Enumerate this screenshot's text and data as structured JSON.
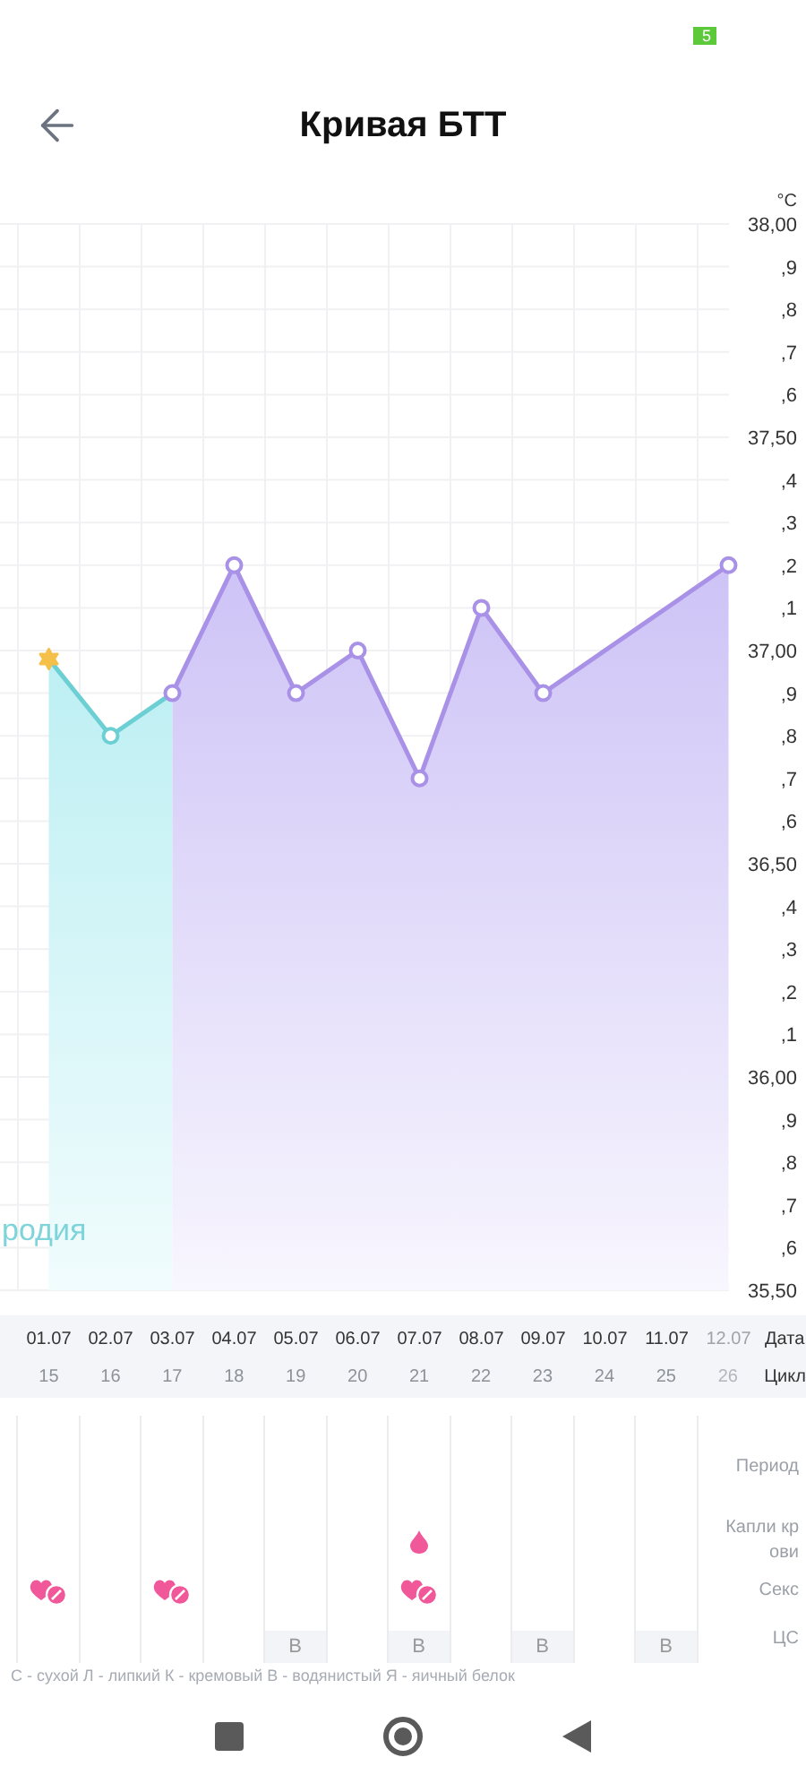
{
  "status_bar": {
    "battery": "5"
  },
  "header": {
    "title": "Кривая БТТ"
  },
  "chart": {
    "unit": "°C",
    "minor_tick_labels": [
      ",9",
      ",8",
      ",7",
      ",6",
      ",4",
      ",3",
      ",2",
      ",1",
      ",9",
      ",8",
      ",7",
      ",6",
      ",4",
      ",3",
      ",2",
      ",1",
      ",9",
      ",8",
      ",7",
      ",6"
    ],
    "chart_data": {
      "type": "line",
      "grid": true,
      "categories": [
        "01.07",
        "02.07",
        "03.07",
        "04.07",
        "05.07",
        "06.07",
        "07.07",
        "08.07",
        "09.07",
        "10.07",
        "11.07",
        "12.07"
      ],
      "series": [
        {
          "name": "родия",
          "color": "#6ccfd4",
          "values": [
            36.98,
            36.8,
            36.9,
            null,
            null,
            null,
            null,
            null,
            null,
            null,
            null,
            null
          ]
        },
        {
          "color": "#a891e6",
          "marker": "circle",
          "values": [
            null,
            null,
            36.9,
            37.2,
            36.9,
            37.0,
            36.7,
            37.1,
            36.9,
            null,
            null,
            37.2
          ]
        },
        {
          "color": "#f5c04a",
          "marker": "cross",
          "values": [
            36.98,
            null,
            null,
            null,
            null,
            null,
            null,
            null,
            null,
            null,
            null,
            null
          ]
        }
      ],
      "ylim": [
        35.5,
        38.0
      ],
      "yticks": [
        {
          "value": 38.0,
          "label": "38,00"
        },
        {
          "value": 37.5,
          "label": "37,50"
        },
        {
          "value": 37.0,
          "label": "37,00"
        },
        {
          "value": 36.5,
          "label": "36,50"
        },
        {
          "value": 36.0,
          "label": "36,00"
        },
        {
          "value": 35.5,
          "label": "35,50"
        }
      ]
    }
  },
  "timeline": {
    "date_label": "Дата",
    "cycle_label": "Цикл",
    "days": [
      {
        "cycle_day": "15",
        "future": false
      },
      {
        "cycle_day": "16",
        "future": false
      },
      {
        "cycle_day": "17",
        "future": false
      },
      {
        "cycle_day": "18",
        "future": false
      },
      {
        "cycle_day": "19",
        "future": false
      },
      {
        "cycle_day": "20",
        "future": false
      },
      {
        "cycle_day": "21",
        "future": false
      },
      {
        "cycle_day": "22",
        "future": false
      },
      {
        "cycle_day": "23",
        "future": false
      },
      {
        "cycle_day": "24",
        "future": false
      },
      {
        "cycle_day": "25",
        "future": false
      },
      {
        "cycle_day": "26",
        "future": true
      }
    ]
  },
  "log": {
    "row_labels": [
      "Период",
      "Капли крови",
      "Секс",
      "ЦС"
    ],
    "days": [
      {
        "sex": true,
        "blood_drops": false
      },
      {
        "sex": false,
        "blood_drops": false
      },
      {
        "sex": true,
        "blood_drops": false
      },
      {
        "sex": false,
        "blood_drops": false
      },
      {
        "sex": false,
        "blood_drops": false,
        "cs": "В"
      },
      {
        "sex": false,
        "blood_drops": false
      },
      {
        "sex": true,
        "blood_drops": true,
        "cs": "В"
      },
      {
        "sex": false,
        "blood_drops": false
      },
      {
        "sex": false,
        "blood_drops": false,
        "cs": "В"
      },
      {
        "sex": false,
        "blood_drops": false
      },
      {
        "sex": false,
        "blood_drops": false,
        "cs": "В"
      }
    ],
    "legend": "С - сухой Л - липкий К - кремовый В - водянистый Я - яичный белок"
  }
}
